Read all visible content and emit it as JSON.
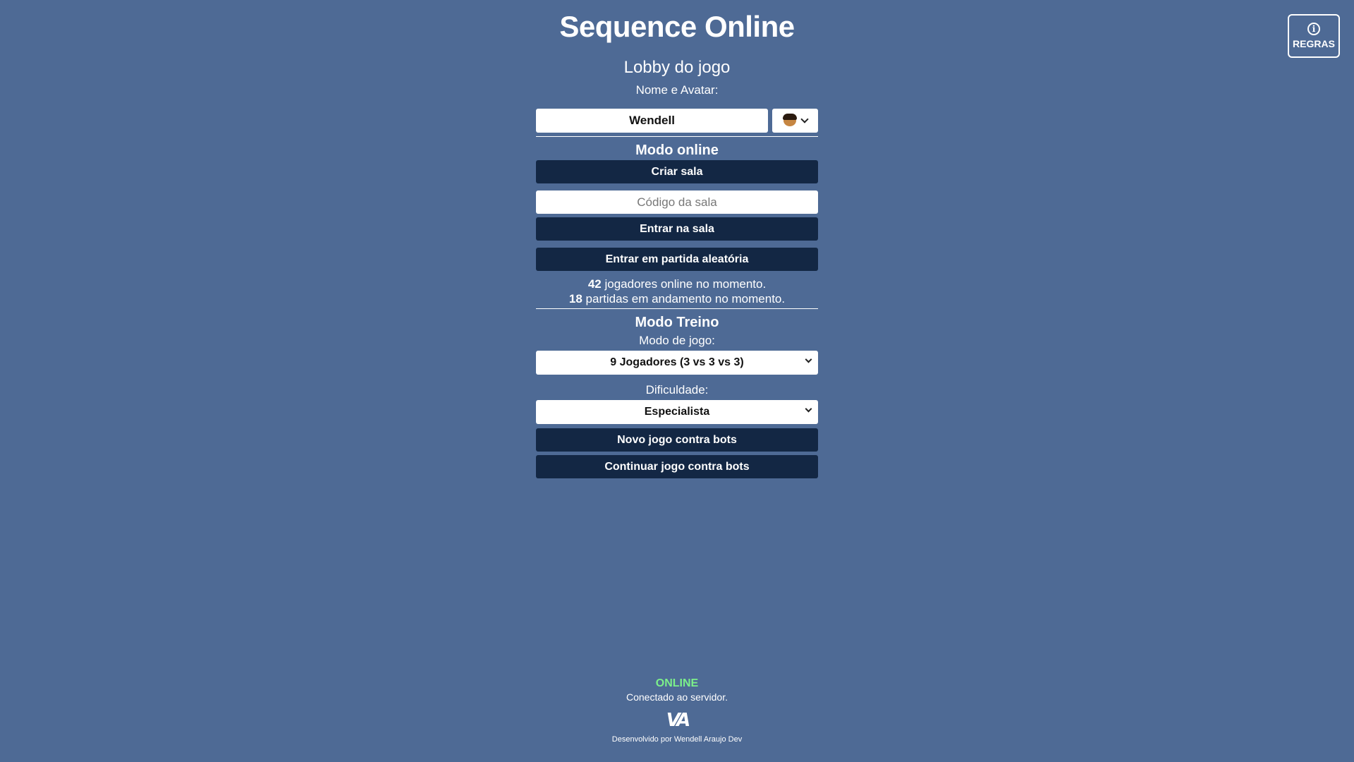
{
  "header": {
    "title": "Sequence Online",
    "subtitle": "Lobby do jogo"
  },
  "rules_button": {
    "label": "REGRAS",
    "icon": "info-icon"
  },
  "profile": {
    "label": "Nome e Avatar:",
    "name_value": "Wendell",
    "avatar_icon": "avatar-face-icon"
  },
  "online_mode": {
    "title": "Modo online",
    "create_room_label": "Criar sala",
    "room_code_placeholder": "Código da sala",
    "join_room_label": "Entrar na sala",
    "random_match_label": "Entrar em partida aleatória",
    "players_online_count": "42",
    "players_online_text": "jogadores online no momento.",
    "matches_count": "18",
    "matches_text": "partidas em andamento no momento."
  },
  "training_mode": {
    "title": "Modo Treino",
    "game_mode_label": "Modo de jogo:",
    "game_mode_value": "9 Jogadores (3 vs 3 vs 3)",
    "difficulty_label": "Dificuldade:",
    "difficulty_value": "Especialista",
    "new_game_label": "Novo jogo contra bots",
    "continue_game_label": "Continuar jogo contra bots"
  },
  "footer": {
    "status": "ONLINE",
    "status_color": "#7cf08a",
    "connection_text": "Conectado ao servidor.",
    "logo_text": "VA",
    "credit": "Desenvolvido por Wendell Araujo Dev"
  },
  "colors": {
    "background": "#4e6a95",
    "button": "#132744"
  }
}
